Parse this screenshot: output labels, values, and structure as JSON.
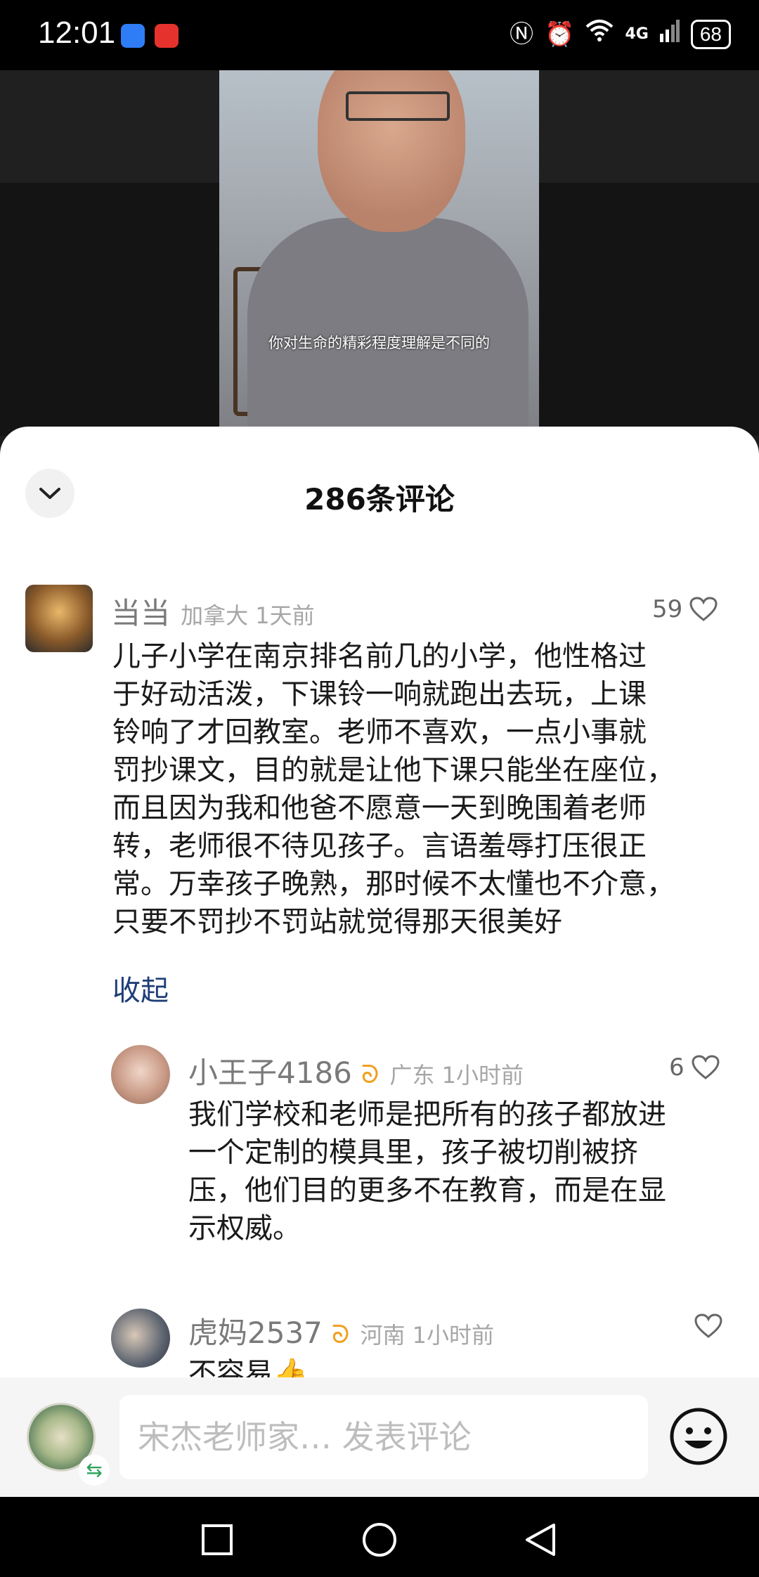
{
  "status_bar": {
    "time": "12:01",
    "network": "4G",
    "battery": "68"
  },
  "video": {
    "subtitle": "你对生命的精彩程度理解是不同的"
  },
  "sheet": {
    "title": "286条评论"
  },
  "comments": [
    {
      "nick": "当当",
      "location_time": "加拿大 1天前",
      "likes": "59",
      "text_lines": [
        "儿子小学在南京排名前几的小学，他性格过",
        "于好动活泼，下课铃一响就跑出去玩，上课",
        "铃响了才回教室。老师不喜欢，一点小事就",
        "罚抄课文，目的就是让他下课只能坐在座位，",
        "而且因为我和他爸不愿意一天到晚围着老师",
        "转，老师很不待见孩子。言语羞辱打压很正",
        "常。万幸孩子晚熟，那时候不太懂也不介意，",
        "只要不罚抄不罚站就觉得那天很美好"
      ],
      "collapse": "收起"
    },
    {
      "nick": "小王子4186",
      "location_time": "广东 1小时前",
      "likes": "6",
      "text_lines": [
        "我们学校和老师是把所有的孩子都放进",
        "一个定制的模具里，孩子被切削被挤",
        "压，他们目的更多不在教育，而是在显",
        "示权威。"
      ]
    },
    {
      "nick": "虎妈2537",
      "location_time": "河南 1小时前",
      "likes": "",
      "text_lines": [
        "不容易👍"
      ]
    }
  ],
  "input": {
    "placeholder": "宋杰老师家… 发表评论"
  },
  "colors": {
    "collapse_link": "#1e3e78",
    "badge": "#f0a020",
    "meta_gray": "#a6a6a6"
  }
}
